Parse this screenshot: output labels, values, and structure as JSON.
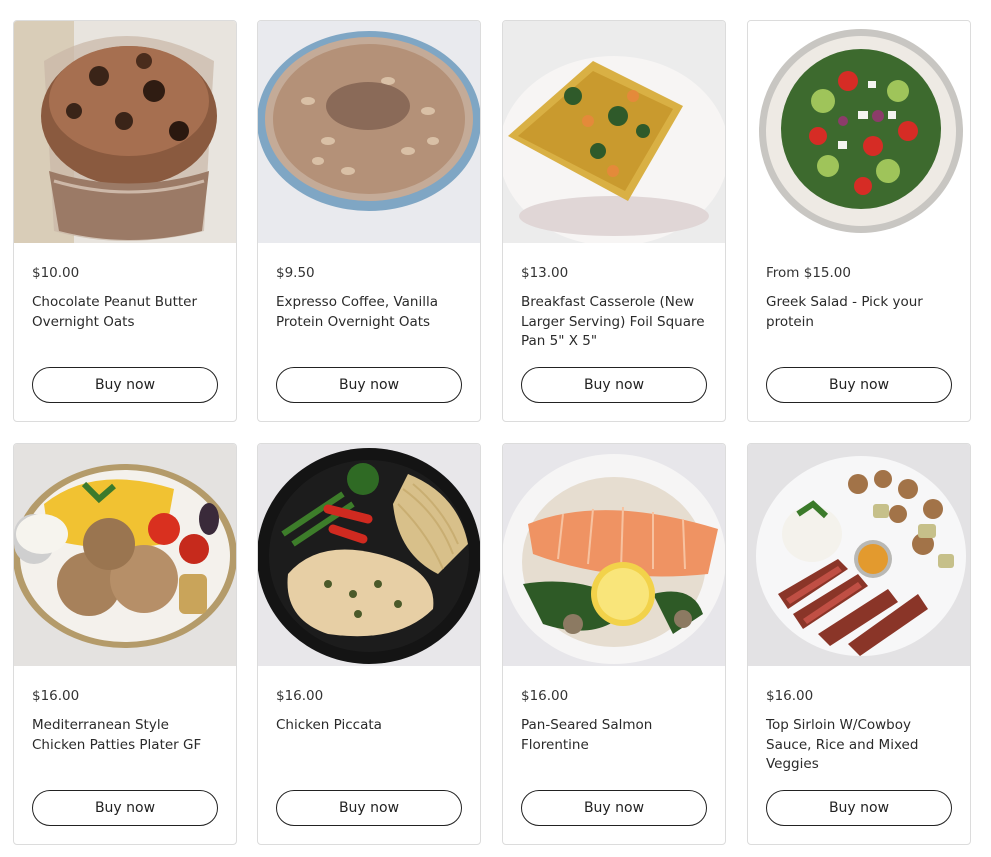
{
  "products": [
    {
      "price": "$10.00",
      "title": "Chocolate Peanut Butter Overnight Oats",
      "button": "Buy now",
      "image": "chocolate-oats-jar"
    },
    {
      "price": "$9.50",
      "title": "Expresso Coffee, Vanilla Protein Overnight Oats",
      "button": "Buy now",
      "image": "coffee-oats-bowl"
    },
    {
      "price": "$13.00",
      "title": "Breakfast Casserole (New Larger Serving) Foil Square Pan 5\" X 5\"",
      "button": "Buy now",
      "image": "breakfast-casserole-plate"
    },
    {
      "price": "From $15.00",
      "title": "Greek Salad - Pick your protein",
      "button": "Buy now",
      "image": "greek-salad-bowl"
    },
    {
      "price": "$16.00",
      "title": "Mediterranean Style Chicken Patties Plater GF",
      "button": "Buy now",
      "image": "chicken-patties-plate"
    },
    {
      "price": "$16.00",
      "title": "Chicken Piccata",
      "button": "Buy now",
      "image": "chicken-piccata-plate"
    },
    {
      "price": "$16.00",
      "title": "Pan-Seared Salmon Florentine",
      "button": "Buy now",
      "image": "salmon-florentine-plate"
    },
    {
      "price": "$16.00",
      "title": "Top Sirloin W/Cowboy Sauce, Rice and Mixed Veggies",
      "button": "Buy now",
      "image": "sirloin-plate"
    }
  ]
}
